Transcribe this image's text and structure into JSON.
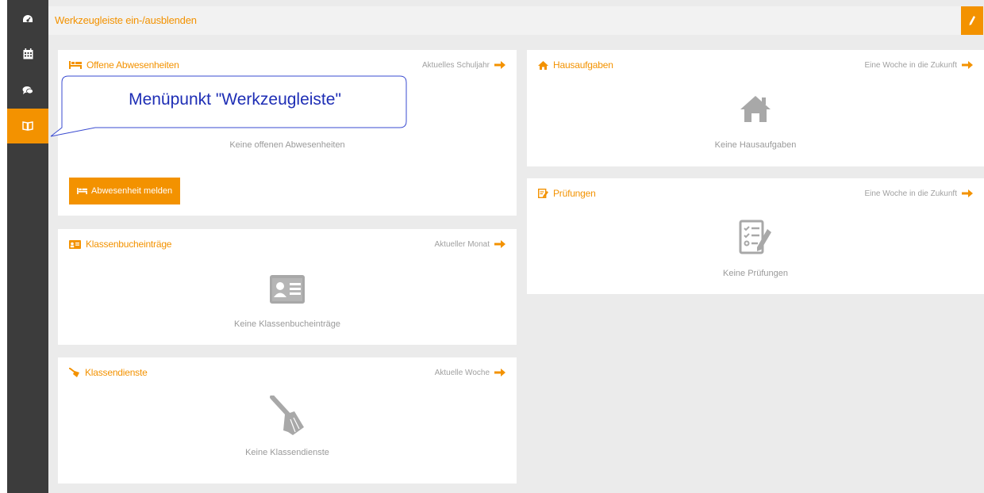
{
  "sidebar": {
    "items": [
      {
        "icon": "dashboard-icon"
      },
      {
        "icon": "calendar-icon"
      },
      {
        "icon": "chat-icon"
      },
      {
        "icon": "book-icon",
        "active": true
      }
    ]
  },
  "topbar": {
    "title": "Werkzeugleiste ein-/ausblenden",
    "edit_icon": "pencil-icon"
  },
  "cards": {
    "absences": {
      "title": "Offene Abwesenheiten",
      "link": "Aktuelles Schuljahr",
      "empty": "Keine offenen Abwesenheiten",
      "button": "Abwesenheit melden"
    },
    "classbook": {
      "title": "Klassenbucheinträge",
      "link": "Aktueller Monat",
      "empty": "Keine Klassenbucheinträge"
    },
    "duties": {
      "title": "Klassendienste",
      "link": "Aktuelle Woche",
      "empty": "Keine Klassendienste"
    },
    "homework": {
      "title": "Hausaufgaben",
      "link": "Eine Woche in die Zukunft",
      "empty": "Keine Hausaufgaben"
    },
    "exams": {
      "title": "Prüfungen",
      "link": "Eine Woche in die Zukunft",
      "empty": "Keine Prüfungen"
    }
  },
  "callout": {
    "text": "Menüpunkt \"Werkzeugleiste\""
  },
  "colors": {
    "accent": "#f39200",
    "sidebar": "#3c3c3c",
    "callout_text": "#1e2eb5"
  }
}
